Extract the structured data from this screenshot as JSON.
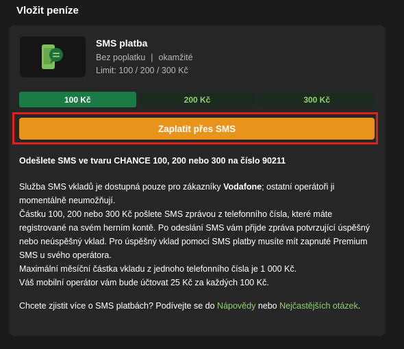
{
  "page": {
    "title": "Vložit peníze"
  },
  "method": {
    "icon": "sms-phone-icon",
    "title": "SMS platba",
    "fee": "Bez poplatku",
    "separator": "|",
    "speed": "okamžité",
    "limit": "Limit: 100 / 200 / 300 Kč"
  },
  "amounts": [
    {
      "label": "100 Kč",
      "selected": true
    },
    {
      "label": "200 Kč",
      "selected": false
    },
    {
      "label": "300 Kč",
      "selected": false
    }
  ],
  "pay_button": {
    "label": "Zaplatit přes SMS"
  },
  "instruction": "Odešlete SMS ve tvaru CHANCE 100, 200 nebo 300 na číslo 90211",
  "info": {
    "line1_pre": "Služba SMS vkladů je dostupná pouze pro zákazníky ",
    "line1_bold": "Vodafone",
    "line1_post": "; ostatní operátoři ji momentálně neumožňují.",
    "line2": "Částku 100, 200 nebo 300 Kč pošlete SMS zprávou z telefonního čísla, které máte registrované na svém herním kontě. Po odeslání SMS vám přijde zpráva potvrzující úspěšný nebo neúspěšný vklad. Pro úspěšný vklad pomocí SMS platby musíte mít zapnuté Premium SMS u svého operátora.",
    "line3": "Maximální měsíční částka vkladu z jednoho telefonního čísla je 1 000 Kč.",
    "line4": "Váš mobilní operátor vám bude účtovat 25 Kč za každých 100 Kč."
  },
  "more": {
    "pre": "Chcete zjistit více o SMS platbách? Podívejte se do ",
    "link1": "Nápovědy",
    "mid": " nebo ",
    "link2": "Nejčastějších otázek",
    "post": "."
  },
  "colors": {
    "accent_green": "#8dd16e",
    "selected_green": "#1b7a45",
    "pay_orange": "#e8931c",
    "highlight_red": "#e0201c"
  }
}
